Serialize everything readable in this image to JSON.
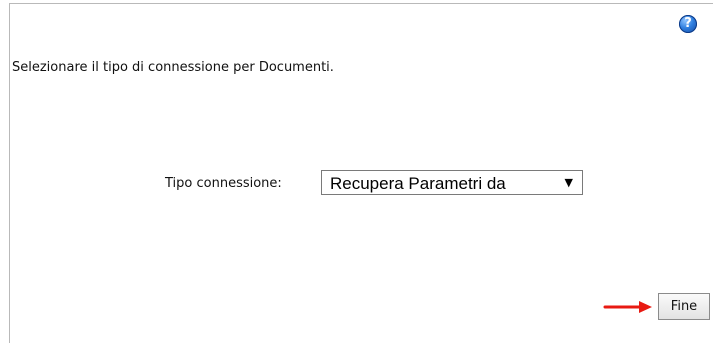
{
  "help": {
    "icon": "help-icon",
    "glyph": "?"
  },
  "instruction": "Selezionare il tipo di connessione per Documenti.",
  "connection": {
    "label": "Tipo connessione:",
    "selected_value": "Recupera Parametri da",
    "arrow": "▼"
  },
  "actions": {
    "finish_label": "Fine",
    "pointer_icon": "red-arrow-icon",
    "pointer_color": "#e81a12"
  }
}
